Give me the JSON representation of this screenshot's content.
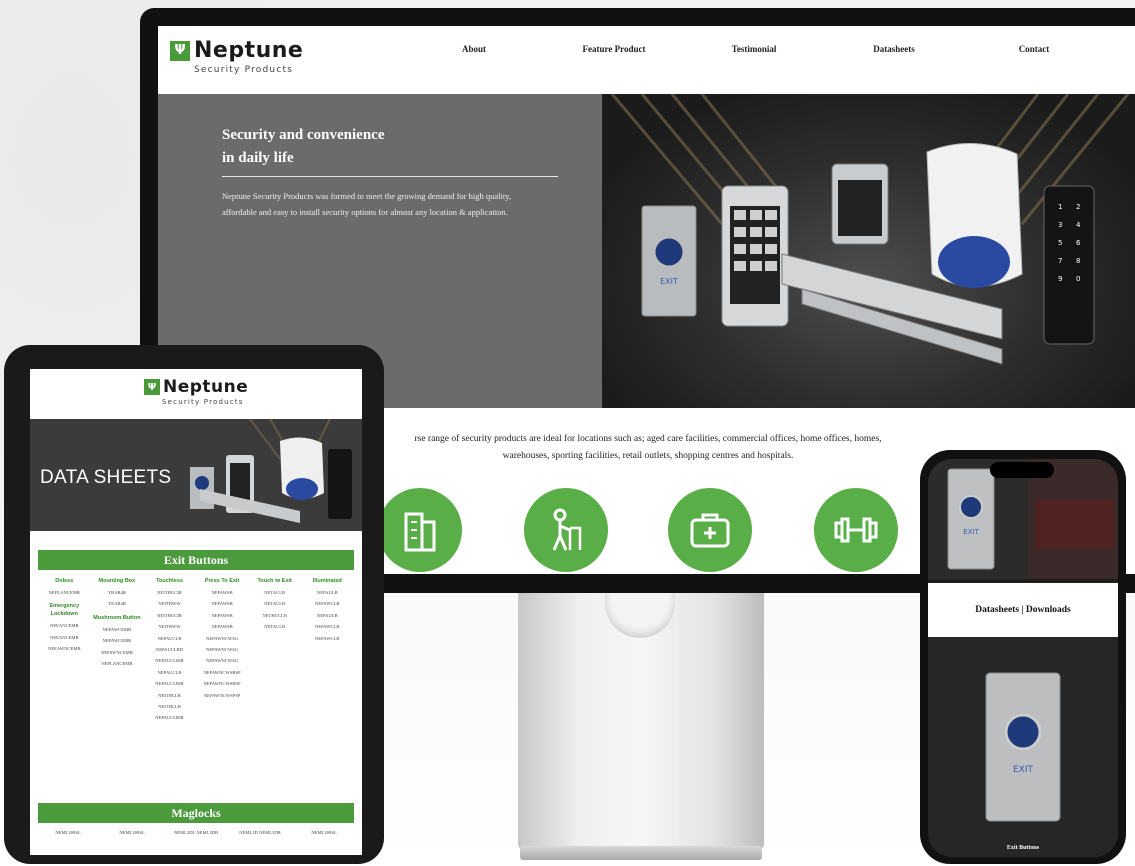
{
  "brand": {
    "name": "Neptune",
    "tagline": "Security Products",
    "color": "#4a9a3c"
  },
  "desktop": {
    "nav": [
      "About",
      "Feature Product",
      "Testimonial",
      "Datasheets",
      "Contact"
    ],
    "hero": {
      "title_line1": "Security and convenience",
      "title_line2": "in daily life",
      "body": "Neptune Security Products was formed to meet the growing demand for high quality, affordable and easy to install security options for almost any location & application."
    },
    "intro_line1": "rse range of security products are ideal for locations such as; aged care facilities, commercial offices, home offices, homes,",
    "intro_line2": "warehouses, sporting facilities, retail outlets, shopping centres and hospitals.",
    "icons": [
      "building-icon",
      "elderly-walker-icon",
      "first-aid-kit-icon",
      "dumbbell-icon"
    ]
  },
  "tablet": {
    "hero_title": "DATA SHEETS",
    "section1_title": "Exit Buttons",
    "columns": [
      {
        "heading": "Doless",
        "items": [
          "NEPLANCEMB"
        ],
        "sub_heading": "Emergency Lockdown",
        "sub_items": [
          "NEEANCEMB",
          "NEEANCEMB",
          "NEEAWNCEMB"
        ]
      },
      {
        "heading": "Mounting Box",
        "items": [
          "YRAB4B",
          "YEAB4B"
        ],
        "sub_heading": "Mushroom Button",
        "sub_items": [
          "NEPAWCEMB",
          "NEPAWCEMB",
          "NEPAWNCEMB",
          "NEPLANCEMB"
        ]
      },
      {
        "heading": "Touchless",
        "items": [
          "NEITHUCIR",
          "NEITBWW",
          "NEITHUCIR",
          "NEITBWW",
          "NEPAUCLB",
          "NEPAUCLBD",
          "NEPAUCLBIR",
          "NEPAUCLB",
          "NEPAUCLBIR",
          "NEITHCLB",
          "NEITHCLB",
          "NEPAUCLBIR"
        ]
      },
      {
        "heading": "Press To Exit",
        "items": [
          "NEPAWSB",
          "NEPAWSB",
          "NEPAWSB",
          "NEPAWSB",
          "NEPAWNCWSG",
          "NEPAWNCWSG",
          "NEPAWNCWSG",
          "NEPAWNCWSBSP",
          "NEPAWNCWSBSP",
          "NEPAWNCWSPSP"
        ]
      },
      {
        "heading": "Touch to Exit",
        "items": [
          "NETACLB",
          "NETACLB",
          "NETHUCLB",
          "NETACLB"
        ]
      },
      {
        "heading": "Illuminated",
        "items": [
          "NEPAULB",
          "NEPAWCLB",
          "NEPAULB",
          "NEPAWCLB",
          "NEPAWCLB"
        ]
      }
    ],
    "section2_title": "Maglocks",
    "maglock_items": [
      "NEML300SL",
      "NEML300SL",
      "NEML3DL NEML3DB",
      "NEML3D NEML3DB",
      "NEML300SL"
    ]
  },
  "phone": {
    "band_title": "Datasheets | Downloads",
    "caption": "Exit Buttons"
  },
  "colors": {
    "accent_green": "#5aae47",
    "hero_gray": "#6b6b6b",
    "bar_green": "#4b9a3c"
  }
}
